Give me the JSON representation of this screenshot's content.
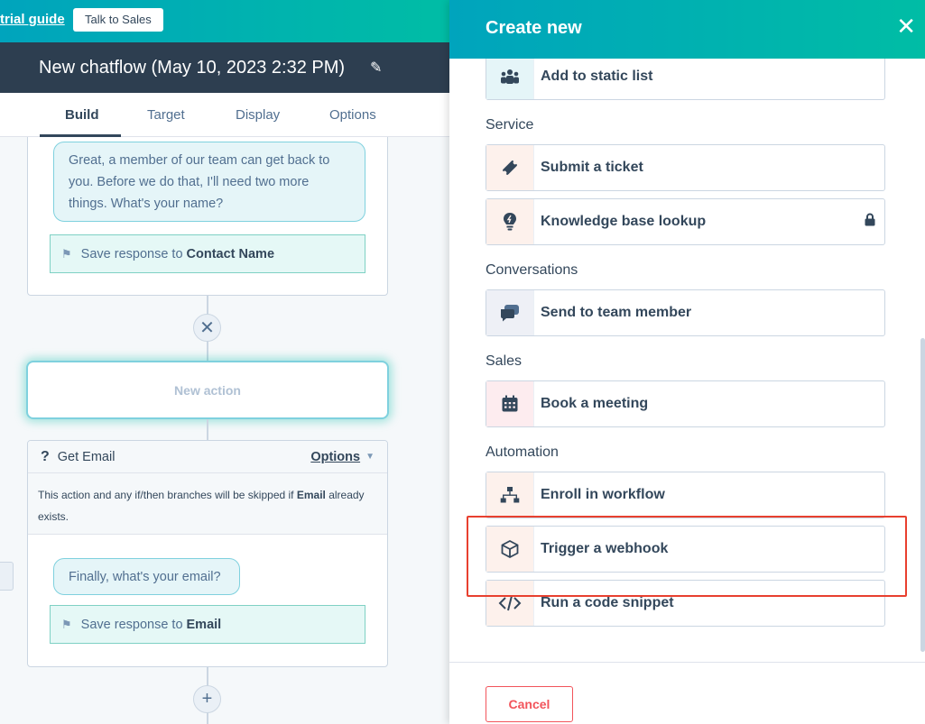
{
  "topbar": {
    "trial_guide": "trial guide",
    "talk_to_sales": "Talk to Sales"
  },
  "chatflow": {
    "title": "New chatflow (May 10, 2023 2:32 PM)"
  },
  "tabs": [
    "Build",
    "Target",
    "Display",
    "Options"
  ],
  "canvas": {
    "name_bubble": "Great, a member of our team can get back to you. Before we do that, I'll need two more things. What's your name?",
    "save_prefix": "Save response to",
    "save_name_target": "Contact Name",
    "new_action": "New action",
    "get_email": {
      "title": "Get Email",
      "options": "Options",
      "note_prefix": "This action and any if/then branches will be skipped if",
      "note_field": "Email",
      "note_suffix": "already exists."
    },
    "email_bubble": "Finally, what's your email?",
    "save_email_target": "Email"
  },
  "panel": {
    "title": "Create new",
    "sections": {
      "service": "Service",
      "conversations": "Conversations",
      "sales": "Sales",
      "automation": "Automation"
    },
    "actions": {
      "add_static_list": "Add to static list",
      "submit_ticket": "Submit a ticket",
      "kb_lookup": "Knowledge base lookup",
      "send_team_member": "Send to team member",
      "book_meeting": "Book a meeting",
      "enroll_workflow": "Enroll in workflow",
      "trigger_webhook": "Trigger a webhook",
      "run_code": "Run a code snippet"
    },
    "cancel": "Cancel"
  },
  "colors": {
    "brand_teal": "#00a4bd",
    "highlight": "#e8402f",
    "cancel": "#f2545b"
  }
}
